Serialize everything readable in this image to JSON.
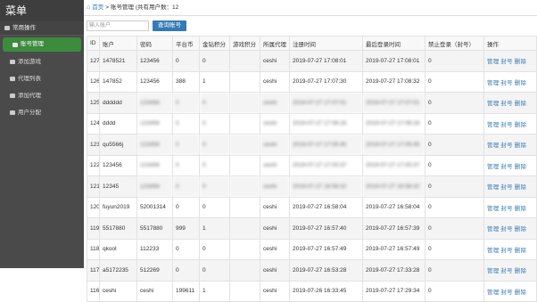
{
  "sidebar": {
    "title": "菜单",
    "group": "常用操作",
    "items": [
      {
        "label": "账号管理",
        "active": true
      },
      {
        "label": "添加游戏",
        "active": false
      },
      {
        "label": "代理列表",
        "active": false
      },
      {
        "label": "添加代理",
        "active": false
      },
      {
        "label": "用户分配",
        "active": false
      }
    ]
  },
  "breadcrumb": {
    "home": "首页",
    "separator": ">",
    "current": "账号管理 (共有用户数：12"
  },
  "search": {
    "placeholder": "输入账户",
    "button": "查询账号"
  },
  "table": {
    "columns": [
      "ID",
      "账户",
      "密码",
      "平台币",
      "金钻积分",
      "游戏积分",
      "所属代理",
      "注册时间",
      "最后登录时间",
      "禁止登录（封号）",
      "操作"
    ],
    "rows": [
      {
        "id": "127",
        "account": "1478521",
        "password": "123456",
        "coins": "0",
        "diamond": "0",
        "game": "",
        "agent": "ceshi",
        "reg": "2019-07-27 17:08:01",
        "last": "2019-07-27 17:08:01",
        "ban": "0",
        "ops": "管理 封号 删除",
        "blur": false
      },
      {
        "id": "126",
        "account": "147852",
        "password": "123456",
        "coins": "388",
        "diamond": "1",
        "game": "",
        "agent": "ceshi",
        "reg": "2019-07-27 17:07:30",
        "last": "2019-07-27 17:08:32",
        "ban": "0",
        "ops": "管理 封号 删除",
        "blur": false
      },
      {
        "id": "125",
        "account": "dddddd",
        "password": "123456",
        "coins": "0",
        "diamond": "0",
        "game": "",
        "agent": "ceshi",
        "reg": "2019-07-27 17:07:01",
        "last": "2019-07-27 17:07:01",
        "ban": "0",
        "ops": "管理 封号 删除",
        "blur": true
      },
      {
        "id": "124",
        "account": "dddd",
        "password": "123456",
        "coins": "0",
        "diamond": "0",
        "game": "",
        "agent": "ceshi",
        "reg": "2019-07-27 17:06:18",
        "last": "2019-07-27 17:06:18",
        "ban": "0",
        "ops": "管理 封号 删除",
        "blur": true
      },
      {
        "id": "123",
        "account": "qu5566j",
        "password": "123456",
        "coins": "0",
        "diamond": "0",
        "game": "",
        "agent": "ceshi",
        "reg": "2019-07-27 17:05:45",
        "last": "2019-07-27 17:05:45",
        "ban": "0",
        "ops": "管理 封号 删除",
        "blur": true
      },
      {
        "id": "122",
        "account": "123456",
        "password": "123456",
        "coins": "0",
        "diamond": "0",
        "game": "",
        "agent": "ceshi",
        "reg": "2019-07-27 17:00:37",
        "last": "2019-07-27 17:00:37",
        "ban": "0",
        "ops": "管理 封号 删除",
        "blur": true
      },
      {
        "id": "121",
        "account": "12345",
        "password": "123456",
        "coins": "0",
        "diamond": "0",
        "game": "",
        "agent": "ceshi",
        "reg": "2019-07-27 16:58:32",
        "last": "2019-07-27 16:58:32",
        "ban": "0",
        "ops": "管理 封号 删除",
        "blur": true
      },
      {
        "id": "120",
        "account": "fuyun2019",
        "password": "52001314",
        "coins": "0",
        "diamond": "0",
        "game": "",
        "agent": "ceshi",
        "reg": "2019-07-27 16:58:04",
        "last": "2019-07-27 16:58:04",
        "ban": "0",
        "ops": "管理 封号 删除",
        "blur": false
      },
      {
        "id": "119",
        "account": "5517880",
        "password": "5517880",
        "coins": "999",
        "diamond": "1",
        "game": "",
        "agent": "ceshi",
        "reg": "2019-07-27 16:57:40",
        "last": "2019-07-27 16:57:39",
        "ban": "0",
        "ops": "管理 封号 删除",
        "blur": false
      },
      {
        "id": "118",
        "account": "qkool",
        "password": "112233",
        "coins": "0",
        "diamond": "0",
        "game": "",
        "agent": "ceshi",
        "reg": "2019-07-27 16:57:49",
        "last": "2019-07-27 16:57:49",
        "ban": "0",
        "ops": "管理 封号 删除",
        "blur": false
      },
      {
        "id": "117",
        "account": "a5172235",
        "password": "512269",
        "coins": "0",
        "diamond": "0",
        "game": "",
        "agent": "ceshi",
        "reg": "2019-07-27 16:53:28",
        "last": "2019-07-27 17:33:28",
        "ban": "0",
        "ops": "管理 封号 删除",
        "blur": false
      },
      {
        "id": "116",
        "account": "ceshi",
        "password": "ceshi",
        "coins": "199611",
        "diamond": "1",
        "game": "",
        "agent": "ceshi",
        "reg": "2019-07-26 16:33:45",
        "last": "2019-07-27 17:29:34",
        "ban": "0",
        "ops": "管理 封号 删除",
        "blur": false
      }
    ]
  }
}
